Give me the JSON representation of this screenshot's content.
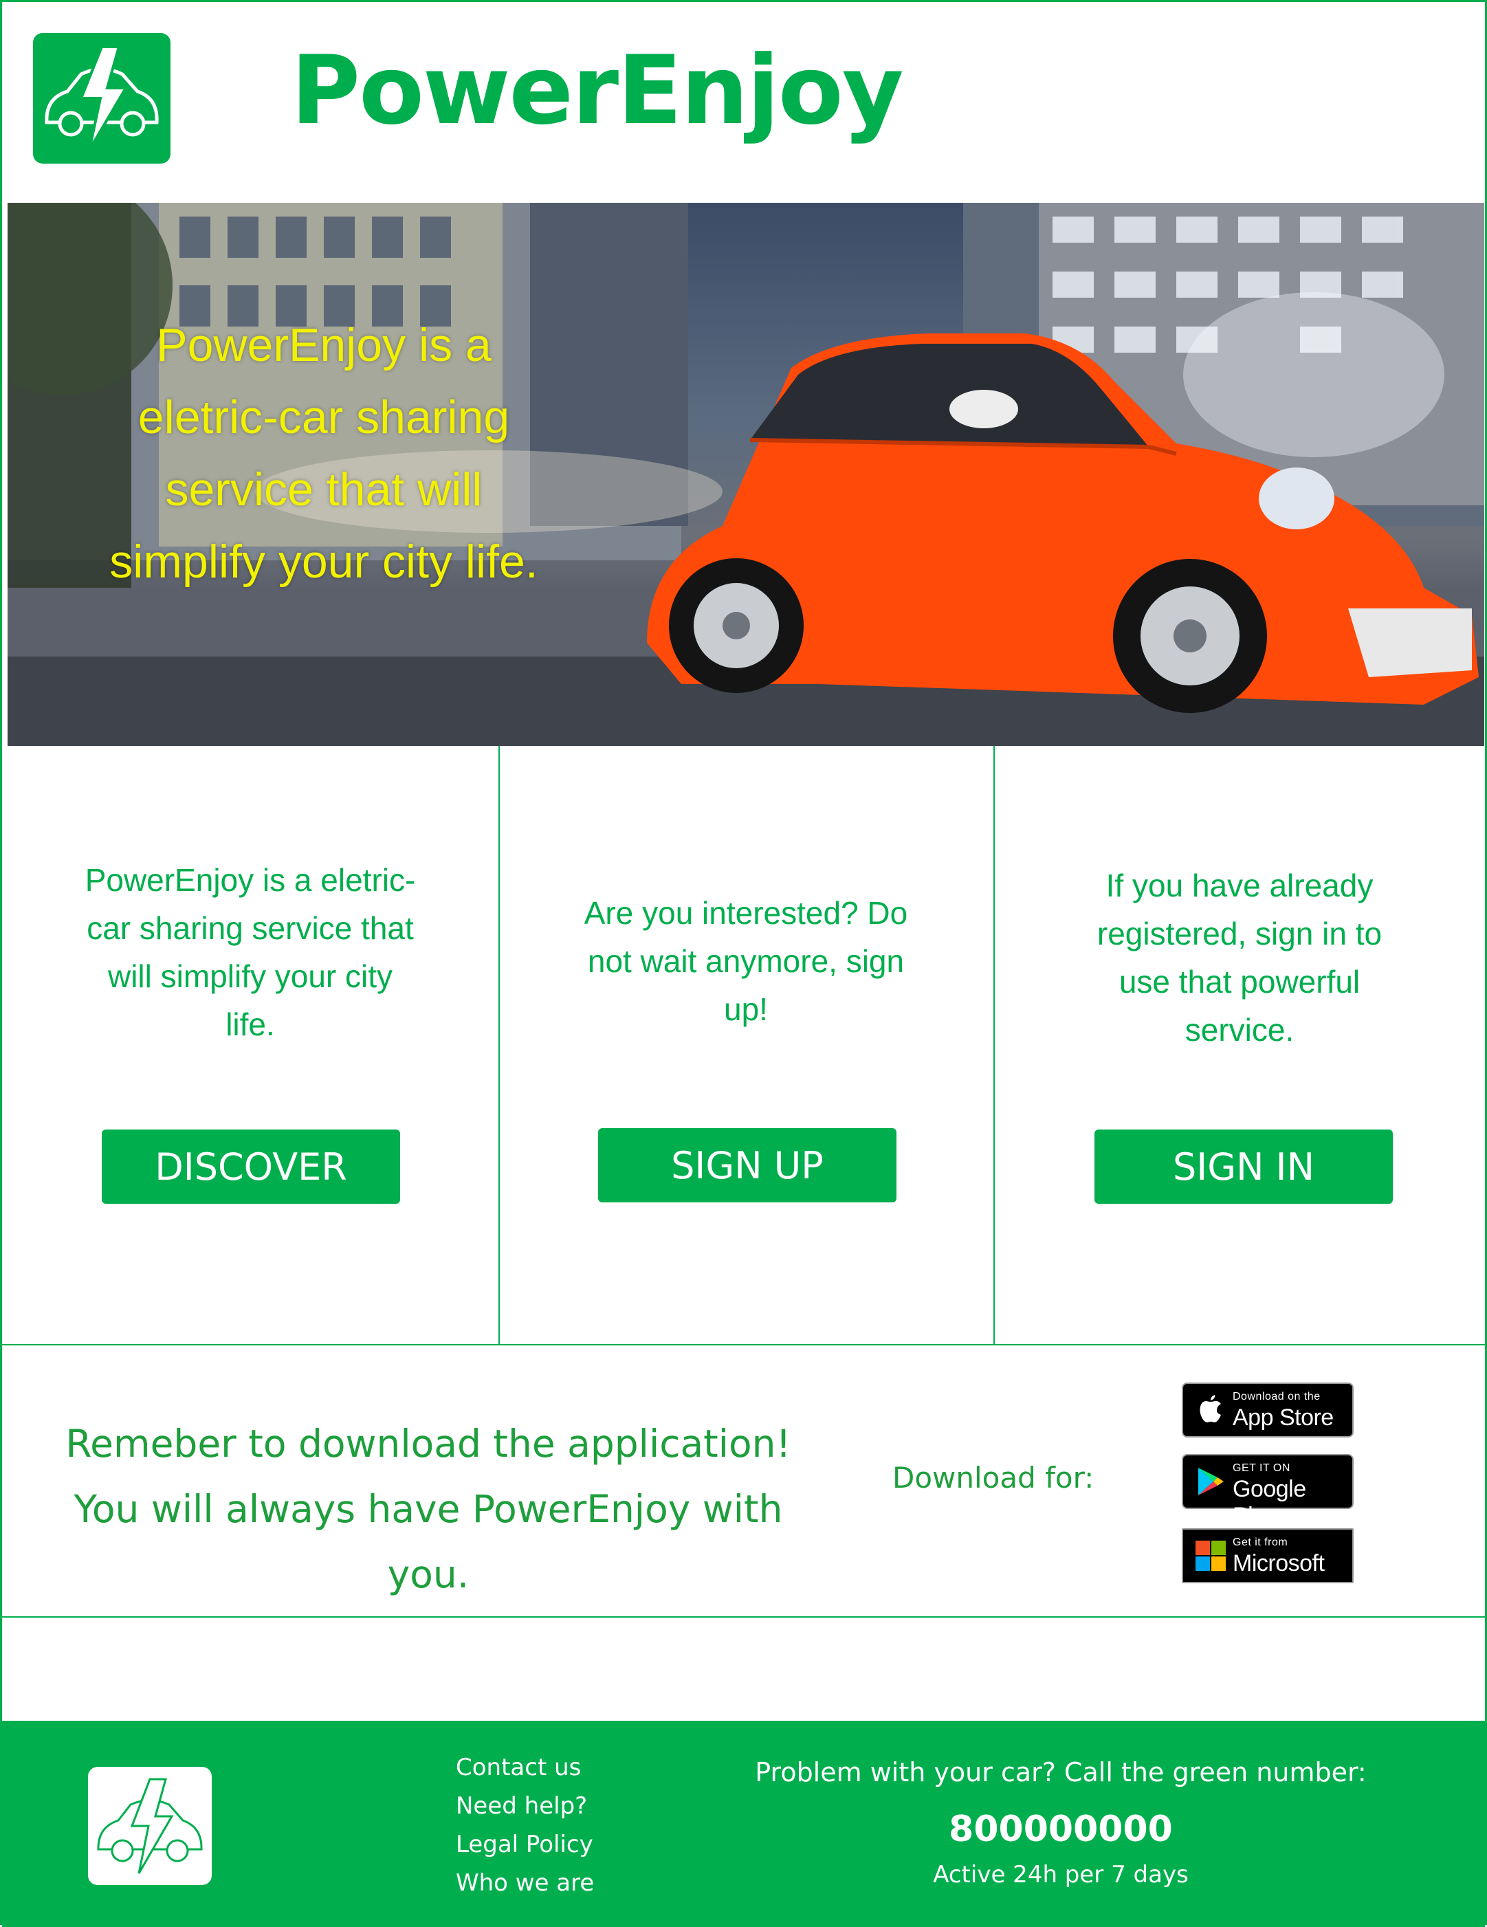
{
  "header": {
    "brand": "PowerEnjoy",
    "logo_icon": "electric-car-bolt-icon"
  },
  "hero": {
    "tagline": "PowerEnjoy is a eletric-car sharing service that will simplify your city life.",
    "image": "orange-electric-car-city-night"
  },
  "features": [
    {
      "text": "PowerEnjoy is a eletric-car sharing service that will simplify your city life.",
      "button": "DISCOVER"
    },
    {
      "text": "Are you interested? Do not wait anymore, sign up!",
      "button": "SIGN UP"
    },
    {
      "text": "If you have already registered, sign in to use that powerful service.",
      "button": "SIGN IN"
    }
  ],
  "download": {
    "line1": "Remeber to download the application!",
    "line2": "You will always have PowerEnjoy with you.",
    "label": "Download for:",
    "stores": [
      {
        "small": "Download on the",
        "big": "App Store",
        "icon": "apple-icon"
      },
      {
        "small": "GET IT ON",
        "big": "Google Play",
        "icon": "google-play-icon"
      },
      {
        "small": "Get it from",
        "big": "Microsoft",
        "icon": "microsoft-icon"
      }
    ]
  },
  "footer": {
    "links": [
      "Contact us",
      "Need help?",
      "Legal Policy",
      "Who we are"
    ],
    "help_question": "Problem with your car? Call the green number:",
    "green_number": "800000000",
    "availability": "Active 24h per 7 days"
  },
  "colors": {
    "brand_green": "#00ae4d",
    "hero_text_yellow": "#f2f200",
    "car_orange": "#ff4a0a"
  }
}
